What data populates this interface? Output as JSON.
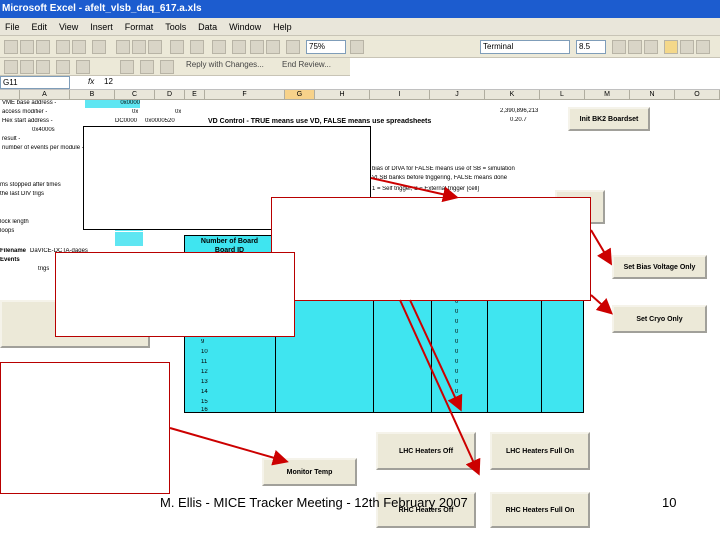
{
  "window": {
    "title": "Microsoft Excel - afelt_vlsb_daq_617.a.xls"
  },
  "menu": [
    "File",
    "Edit",
    "View",
    "Insert",
    "Format",
    "Tools",
    "Data",
    "Window",
    "Help"
  ],
  "toolbar": {
    "zoom": "75%",
    "font": "Terminal",
    "size": "8.5",
    "review_label": "Reply with Changes...",
    "end_review_label": "End Review..."
  },
  "formula": {
    "namebox": "G11",
    "fx": "fx",
    "value": "12"
  },
  "columns": [
    "A",
    "B",
    "C",
    "D",
    "E",
    "F",
    "G",
    "H",
    "I",
    "J",
    "K",
    "L",
    "M",
    "N",
    "O"
  ],
  "cells": {
    "r1a": "VME base address -",
    "r2a": "access modifier -",
    "r3a": "Hex start address -",
    "r4a": "0x4000s",
    "r5a": "result -",
    "r6a": "number of events per module -",
    "c1": "0x0000",
    "c2": "0x",
    "d2": "0x",
    "c3": "DC0000",
    "d3": "0x0000520",
    "e3": "VD Control - TRUE means use VD, FALSE means use spreadsheets",
    "j1": "2,390,896,213",
    "j2": "0.20.7",
    "fbrk": "bias of DIVA for FALSE means use of SB = simulation",
    "fbr2": "VLSB banks before triggering, FALSE means done",
    "fbr3": "1 = Self trigger, 2 = External trigger [cell]",
    "leftlab1": "ms stopped after times",
    "leftlab2": "the last DIV trigs",
    "leftlab3": "lock length",
    "leftlab4": "loops",
    "filename": "Filename",
    "filevalue": "DaVICE-DCTA-daqes",
    "events": "Events",
    "events2": "trigs",
    "tbl_header1": "Number of Board",
    "tbl_header2": "Board ID"
  },
  "table": {
    "rows": [
      "9",
      "10",
      "11",
      "12",
      "13",
      "14",
      "15",
      "16"
    ],
    "zeros": [
      "0",
      "0",
      "0",
      "0",
      "0",
      "0",
      "0",
      "0",
      "0",
      "0",
      "0",
      "0"
    ]
  },
  "buttons": {
    "init": "Init BK2 Boardset",
    "bias": "Set Bias Voltage Only",
    "cryo": "Set Cryo Only",
    "monitor": "Monitor Temp",
    "lhc_off": "LHC Heaters Off",
    "lhc_full": "LHC Heaters Full On",
    "rhc_off": "RHC Heaters Off",
    "rhc_full": "RHC Heaters Full On"
  },
  "footer": {
    "caption": "M. Ellis - MICE Tracker Meeting - 12th February 2007",
    "page": "10"
  }
}
